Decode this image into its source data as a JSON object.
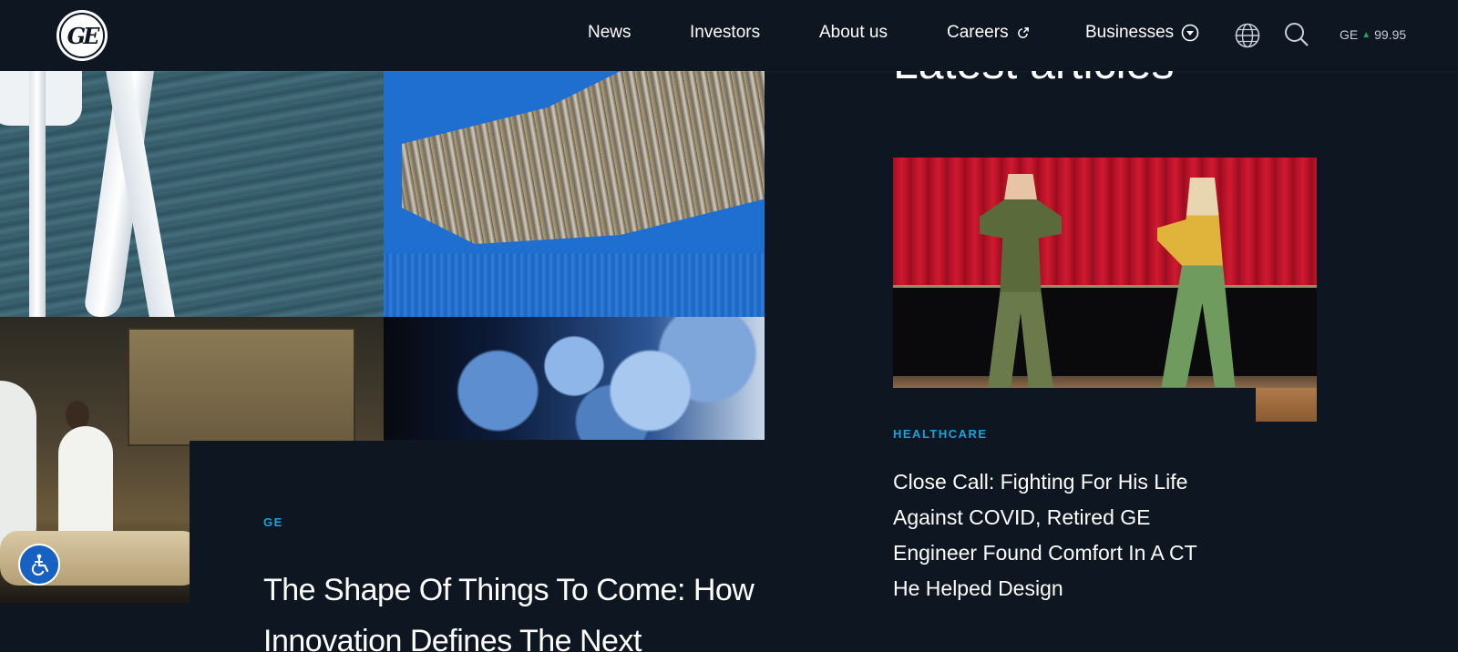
{
  "header": {
    "logo_alt": "GE",
    "nav": [
      {
        "label": "News"
      },
      {
        "label": "Investors"
      },
      {
        "label": "About us"
      },
      {
        "label": "Careers"
      },
      {
        "label": "Businesses"
      }
    ],
    "icons": {
      "careers": "external-link-icon",
      "businesses": "chevron-down-circle-icon",
      "language": "globe-icon",
      "search": "search-icon"
    },
    "ticker": {
      "symbol": "GE",
      "direction": "up",
      "price": "99.95"
    }
  },
  "hero": {
    "category": "GE",
    "title": "The Shape Of Things To Come: How Innovation Defines The Next"
  },
  "latest": {
    "heading": "Latest articles",
    "article": {
      "category": "HEALTHCARE",
      "title": "Close Call: Fighting For His Life Against COVID, Retired GE Engineer Found Comfort In A CT He Helped Design"
    }
  },
  "accessibility": {
    "icon": "wheelchair-accessibility-icon"
  },
  "colors": {
    "background": "#0e1622",
    "category_accent": "#1aa3d9",
    "ticker_up": "#1fa35b",
    "accessibility_button": "#1661c2"
  }
}
